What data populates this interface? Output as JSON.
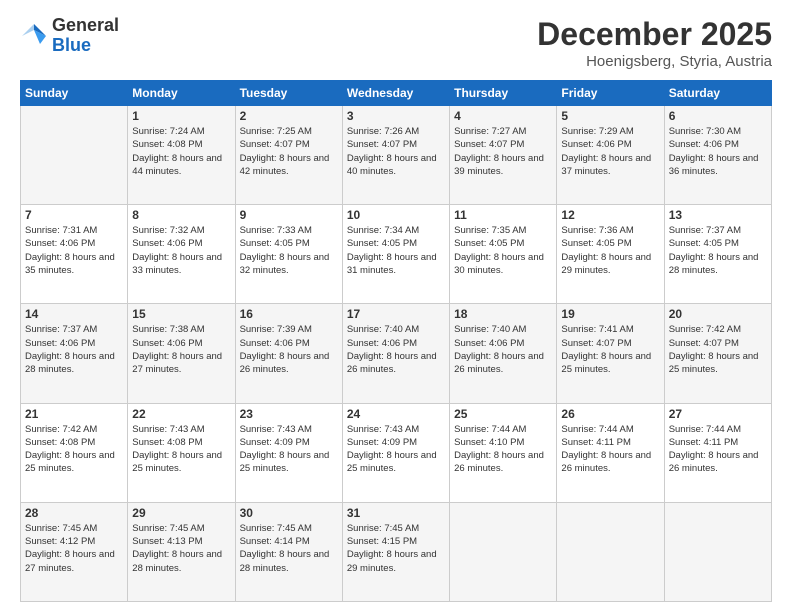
{
  "logo": {
    "general": "General",
    "blue": "Blue"
  },
  "header": {
    "month": "December 2025",
    "location": "Hoenigsberg, Styria, Austria"
  },
  "days_of_week": [
    "Sunday",
    "Monday",
    "Tuesday",
    "Wednesday",
    "Thursday",
    "Friday",
    "Saturday"
  ],
  "weeks": [
    [
      {
        "day": "",
        "sunrise": "",
        "sunset": "",
        "daylight": ""
      },
      {
        "day": "1",
        "sunrise": "Sunrise: 7:24 AM",
        "sunset": "Sunset: 4:08 PM",
        "daylight": "Daylight: 8 hours and 44 minutes."
      },
      {
        "day": "2",
        "sunrise": "Sunrise: 7:25 AM",
        "sunset": "Sunset: 4:07 PM",
        "daylight": "Daylight: 8 hours and 42 minutes."
      },
      {
        "day": "3",
        "sunrise": "Sunrise: 7:26 AM",
        "sunset": "Sunset: 4:07 PM",
        "daylight": "Daylight: 8 hours and 40 minutes."
      },
      {
        "day": "4",
        "sunrise": "Sunrise: 7:27 AM",
        "sunset": "Sunset: 4:07 PM",
        "daylight": "Daylight: 8 hours and 39 minutes."
      },
      {
        "day": "5",
        "sunrise": "Sunrise: 7:29 AM",
        "sunset": "Sunset: 4:06 PM",
        "daylight": "Daylight: 8 hours and 37 minutes."
      },
      {
        "day": "6",
        "sunrise": "Sunrise: 7:30 AM",
        "sunset": "Sunset: 4:06 PM",
        "daylight": "Daylight: 8 hours and 36 minutes."
      }
    ],
    [
      {
        "day": "7",
        "sunrise": "Sunrise: 7:31 AM",
        "sunset": "Sunset: 4:06 PM",
        "daylight": "Daylight: 8 hours and 35 minutes."
      },
      {
        "day": "8",
        "sunrise": "Sunrise: 7:32 AM",
        "sunset": "Sunset: 4:06 PM",
        "daylight": "Daylight: 8 hours and 33 minutes."
      },
      {
        "day": "9",
        "sunrise": "Sunrise: 7:33 AM",
        "sunset": "Sunset: 4:05 PM",
        "daylight": "Daylight: 8 hours and 32 minutes."
      },
      {
        "day": "10",
        "sunrise": "Sunrise: 7:34 AM",
        "sunset": "Sunset: 4:05 PM",
        "daylight": "Daylight: 8 hours and 31 minutes."
      },
      {
        "day": "11",
        "sunrise": "Sunrise: 7:35 AM",
        "sunset": "Sunset: 4:05 PM",
        "daylight": "Daylight: 8 hours and 30 minutes."
      },
      {
        "day": "12",
        "sunrise": "Sunrise: 7:36 AM",
        "sunset": "Sunset: 4:05 PM",
        "daylight": "Daylight: 8 hours and 29 minutes."
      },
      {
        "day": "13",
        "sunrise": "Sunrise: 7:37 AM",
        "sunset": "Sunset: 4:05 PM",
        "daylight": "Daylight: 8 hours and 28 minutes."
      }
    ],
    [
      {
        "day": "14",
        "sunrise": "Sunrise: 7:37 AM",
        "sunset": "Sunset: 4:06 PM",
        "daylight": "Daylight: 8 hours and 28 minutes."
      },
      {
        "day": "15",
        "sunrise": "Sunrise: 7:38 AM",
        "sunset": "Sunset: 4:06 PM",
        "daylight": "Daylight: 8 hours and 27 minutes."
      },
      {
        "day": "16",
        "sunrise": "Sunrise: 7:39 AM",
        "sunset": "Sunset: 4:06 PM",
        "daylight": "Daylight: 8 hours and 26 minutes."
      },
      {
        "day": "17",
        "sunrise": "Sunrise: 7:40 AM",
        "sunset": "Sunset: 4:06 PM",
        "daylight": "Daylight: 8 hours and 26 minutes."
      },
      {
        "day": "18",
        "sunrise": "Sunrise: 7:40 AM",
        "sunset": "Sunset: 4:06 PM",
        "daylight": "Daylight: 8 hours and 26 minutes."
      },
      {
        "day": "19",
        "sunrise": "Sunrise: 7:41 AM",
        "sunset": "Sunset: 4:07 PM",
        "daylight": "Daylight: 8 hours and 25 minutes."
      },
      {
        "day": "20",
        "sunrise": "Sunrise: 7:42 AM",
        "sunset": "Sunset: 4:07 PM",
        "daylight": "Daylight: 8 hours and 25 minutes."
      }
    ],
    [
      {
        "day": "21",
        "sunrise": "Sunrise: 7:42 AM",
        "sunset": "Sunset: 4:08 PM",
        "daylight": "Daylight: 8 hours and 25 minutes."
      },
      {
        "day": "22",
        "sunrise": "Sunrise: 7:43 AM",
        "sunset": "Sunset: 4:08 PM",
        "daylight": "Daylight: 8 hours and 25 minutes."
      },
      {
        "day": "23",
        "sunrise": "Sunrise: 7:43 AM",
        "sunset": "Sunset: 4:09 PM",
        "daylight": "Daylight: 8 hours and 25 minutes."
      },
      {
        "day": "24",
        "sunrise": "Sunrise: 7:43 AM",
        "sunset": "Sunset: 4:09 PM",
        "daylight": "Daylight: 8 hours and 25 minutes."
      },
      {
        "day": "25",
        "sunrise": "Sunrise: 7:44 AM",
        "sunset": "Sunset: 4:10 PM",
        "daylight": "Daylight: 8 hours and 26 minutes."
      },
      {
        "day": "26",
        "sunrise": "Sunrise: 7:44 AM",
        "sunset": "Sunset: 4:11 PM",
        "daylight": "Daylight: 8 hours and 26 minutes."
      },
      {
        "day": "27",
        "sunrise": "Sunrise: 7:44 AM",
        "sunset": "Sunset: 4:11 PM",
        "daylight": "Daylight: 8 hours and 26 minutes."
      }
    ],
    [
      {
        "day": "28",
        "sunrise": "Sunrise: 7:45 AM",
        "sunset": "Sunset: 4:12 PM",
        "daylight": "Daylight: 8 hours and 27 minutes."
      },
      {
        "day": "29",
        "sunrise": "Sunrise: 7:45 AM",
        "sunset": "Sunset: 4:13 PM",
        "daylight": "Daylight: 8 hours and 28 minutes."
      },
      {
        "day": "30",
        "sunrise": "Sunrise: 7:45 AM",
        "sunset": "Sunset: 4:14 PM",
        "daylight": "Daylight: 8 hours and 28 minutes."
      },
      {
        "day": "31",
        "sunrise": "Sunrise: 7:45 AM",
        "sunset": "Sunset: 4:15 PM",
        "daylight": "Daylight: 8 hours and 29 minutes."
      },
      {
        "day": "",
        "sunrise": "",
        "sunset": "",
        "daylight": ""
      },
      {
        "day": "",
        "sunrise": "",
        "sunset": "",
        "daylight": ""
      },
      {
        "day": "",
        "sunrise": "",
        "sunset": "",
        "daylight": ""
      }
    ]
  ]
}
